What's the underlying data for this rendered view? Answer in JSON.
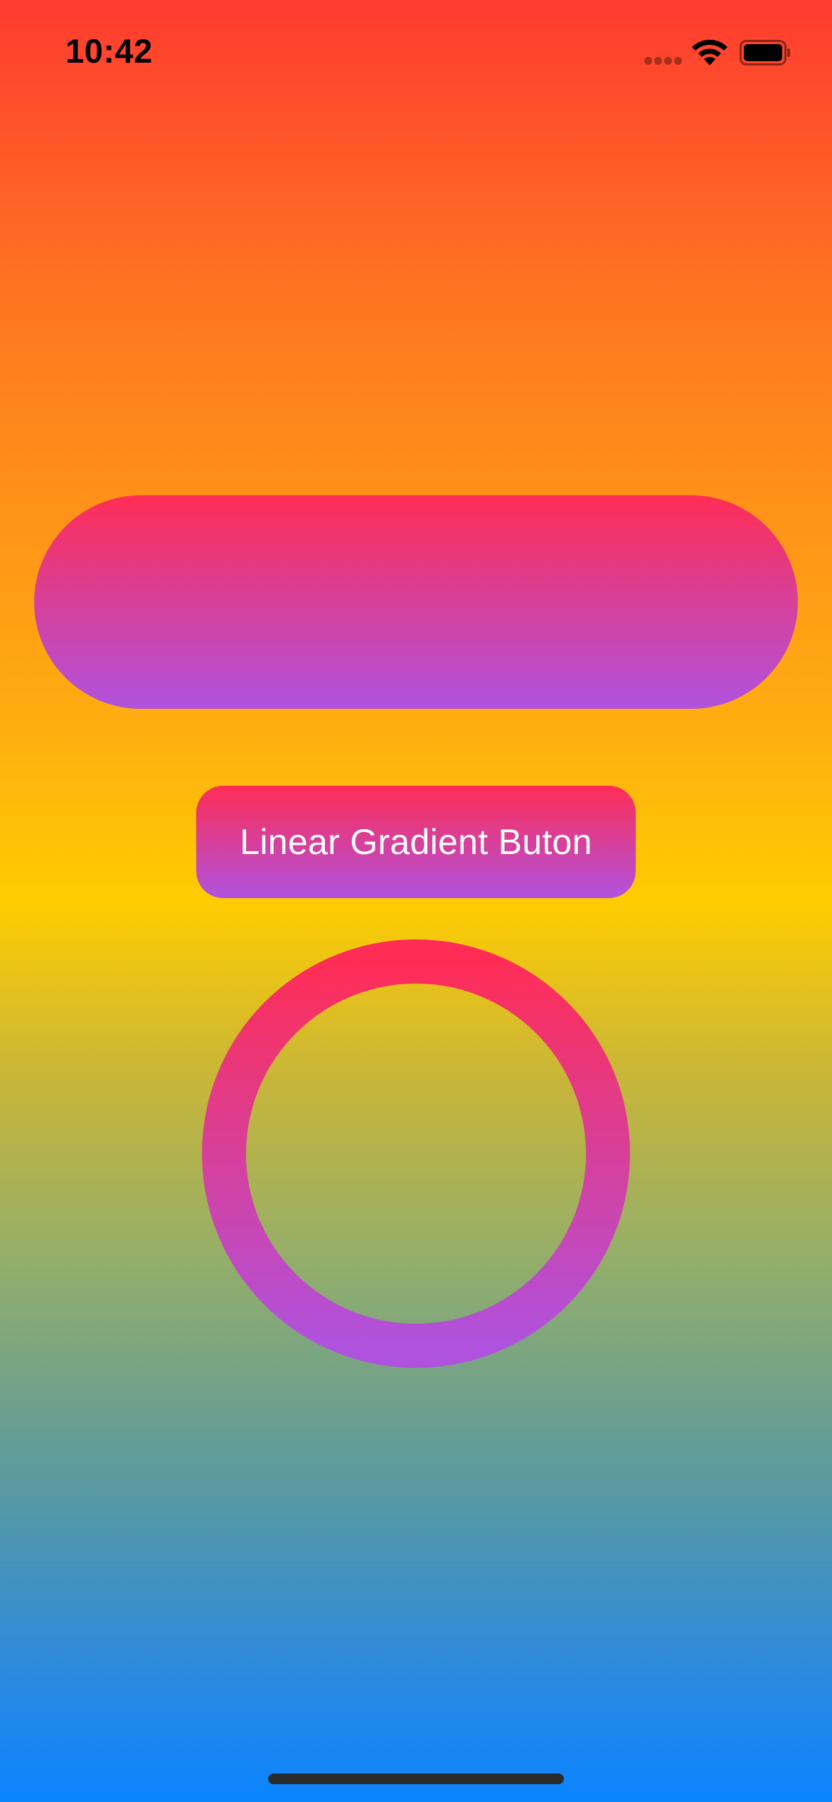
{
  "status_bar": {
    "time": "10:42",
    "wifi_icon": "wifi-icon",
    "battery_icon": "battery-icon",
    "signal_icon": "signal-dots-icon"
  },
  "background": {
    "gradient_colors": [
      "#ff3b30",
      "#ff9500",
      "#ffcc00",
      "#34c759",
      "#0a84ff"
    ]
  },
  "pill_button": {
    "gradient_colors": [
      "#ff2d55",
      "#af52de"
    ]
  },
  "gradient_button": {
    "label": "Linear Gradient Buton",
    "gradient_colors": [
      "#ff2d55",
      "#af52de"
    ],
    "text_color": "#ffffff"
  },
  "ring": {
    "gradient_colors": [
      "#ff2d55",
      "#af52de"
    ]
  }
}
